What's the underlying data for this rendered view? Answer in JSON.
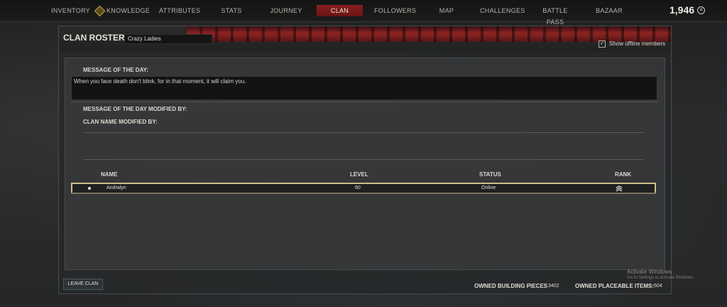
{
  "nav": {
    "tabs": [
      {
        "label": "INVENTORY"
      },
      {
        "label": "KNOWLEDGE"
      },
      {
        "label": "ATTRIBUTES"
      },
      {
        "label": "STATS"
      },
      {
        "label": "JOURNEY"
      },
      {
        "label": "CLAN"
      },
      {
        "label": "FOLLOWERS"
      },
      {
        "label": "MAP"
      },
      {
        "label": "CHALLENGES"
      },
      {
        "label": "BATTLE PASS"
      },
      {
        "label": "BAZAAR"
      }
    ],
    "active_tab": "CLAN",
    "currency_value": "1,946",
    "currency_icon": "crom-coin-icon"
  },
  "clan": {
    "title": "CLAN ROSTER",
    "name": "Crazy Ladies",
    "show_offline_label": "Show offline members",
    "show_offline_checked": true,
    "motd_label": "MESSAGE OF THE DAY:",
    "motd_text": "When you face death don't blink, for in that moment, it will claim you.",
    "motd_modified_label": "MESSAGE OF THE DAY MODIFIED BY:",
    "name_modified_label": "CLAN NAME MODIFIED BY:"
  },
  "roster": {
    "columns": [
      "NAME",
      "LEVEL",
      "STATUS",
      "RANK"
    ],
    "rows": [
      {
        "name": "Andralyn",
        "level": "60",
        "status": "Online",
        "rank_icon": "rank-chevrons-icon"
      }
    ]
  },
  "footer": {
    "leave_label": "LEAVE CLAN",
    "building_label": "OWNED BUILDING PIECES",
    "building_value": "3402",
    "placeable_label": "OWNED PLACEABLE ITEMS:",
    "placeable_value": "604"
  },
  "watermark": {
    "line1": "Activate Windows",
    "line2": "Go to Settings to activate Windows."
  },
  "colors": {
    "active_tab": "#8a1f1f",
    "row_border": "#cdbd8a",
    "knowledge_icon": "#c9a44a"
  }
}
